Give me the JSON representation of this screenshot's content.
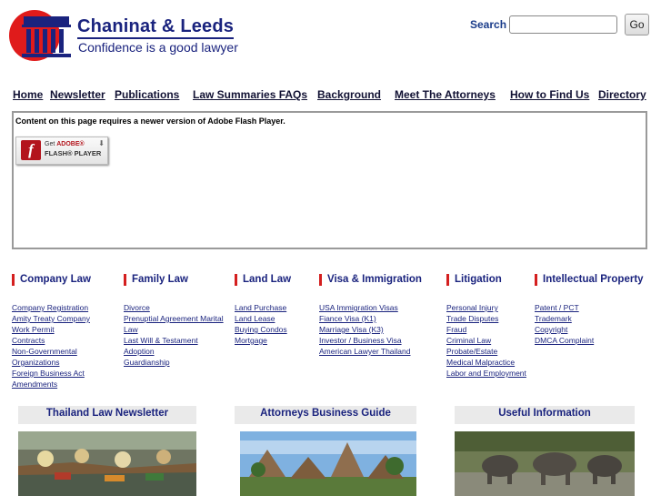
{
  "header": {
    "title": "Chaninat & Leeds",
    "tagline": "Confidence is a good lawyer"
  },
  "search": {
    "label": "Search",
    "value": "",
    "placeholder": "",
    "button": "Go"
  },
  "nav": [
    "Home",
    "Newsletter",
    "Publications",
    "Law Summaries FAQs",
    "Background",
    "Meet The Attorneys",
    "How to Find Us",
    "Directory"
  ],
  "flash": {
    "message": "Content on this page requires a newer version of Adobe Flash Player.",
    "get": "Get",
    "adobe": "ADOBE®",
    "player": "FLASH® PLAYER"
  },
  "categories": [
    {
      "title": "Company Law",
      "links": [
        "Company Registration",
        "Amity Treaty Company",
        "Work Permit",
        "Contracts",
        "Non-Governmental",
        "Organizations",
        "Foreign Business Act",
        "Amendments"
      ]
    },
    {
      "title": "Family Law",
      "links": [
        "Divorce",
        "Prenuptial Agreement Marital",
        "Law",
        "Last Will & Testament",
        "Adoption",
        "Guardianship"
      ]
    },
    {
      "title": "Land Law",
      "links": [
        "Land Purchase",
        "Land Lease",
        "Buying Condos",
        "Mortgage"
      ]
    },
    {
      "title": "Visa & Immigration",
      "links": [
        "USA Immigration Visas",
        "Fiance Visa (K1)",
        "Marriage Visa (K3)",
        "Investor / Business Visa",
        "American Lawyer Thailand"
      ]
    },
    {
      "title": "Litigation",
      "links": [
        "Personal Injury",
        "Trade Disputes",
        "Fraud",
        "Criminal Law",
        "Probate/Estate",
        "Medical Malpractice",
        "Labor and Employment"
      ]
    },
    {
      "title": "Intellectual Property",
      "links": [
        "Patent / PCT",
        "Trademark",
        "Copyright",
        "DMCA Complaint"
      ]
    }
  ],
  "panels": [
    "Thailand Law Newsletter",
    "Attorneys Business Guide",
    "Useful Information"
  ],
  "colors": {
    "brand": "#1a237e",
    "accent_red": "#d41f1f",
    "panel_bg": "#eaeaea"
  }
}
